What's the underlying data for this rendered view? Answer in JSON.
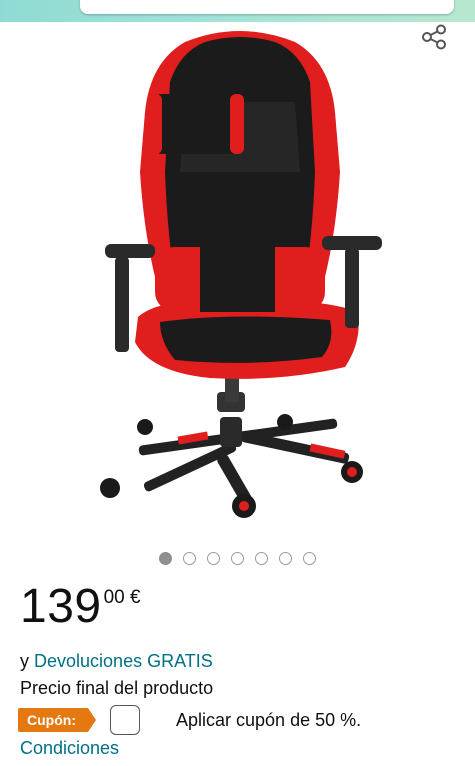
{
  "product": {
    "image_alt": "Gaming chair red and black"
  },
  "carousel": {
    "count": 7,
    "active_index": 0
  },
  "price": {
    "whole": "139",
    "fraction": "00 €"
  },
  "returns": {
    "prefix": "y ",
    "link": "Devoluciones GRATIS"
  },
  "final_price_label": "Precio final del producto",
  "coupon": {
    "tag": "Cupón:",
    "text": "Aplicar cupón de 50 %.",
    "checked": false
  },
  "conditions_link": "Condiciones",
  "colors": {
    "link": "#007185",
    "coupon_tag": "#e47911",
    "header_gradient": "#a4e3d8"
  },
  "icons": {
    "share": "share-icon"
  }
}
